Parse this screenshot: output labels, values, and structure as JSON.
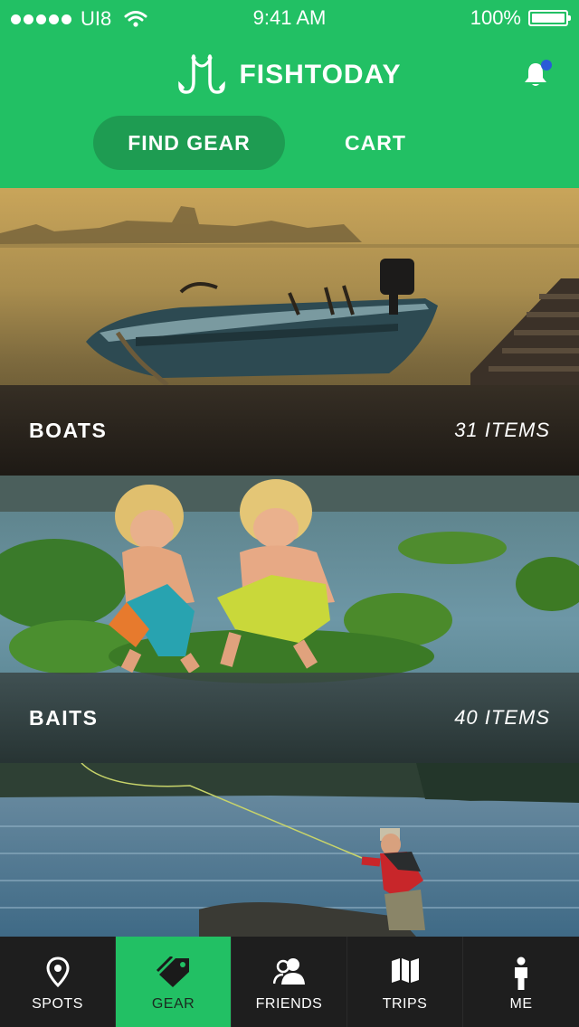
{
  "status_bar": {
    "carrier": "UI8",
    "time": "9:41 AM",
    "battery": "100%",
    "battery_level": 1.0
  },
  "header": {
    "app_name": "FISHTODAY",
    "has_notification": true
  },
  "tabs": [
    {
      "label": "FIND GEAR",
      "active": true
    },
    {
      "label": "CART",
      "active": false
    }
  ],
  "categories": [
    {
      "name": "BOATS",
      "count": "31 ITEMS"
    },
    {
      "name": "BAITS",
      "count": "40 ITEMS"
    }
  ],
  "tabbar": [
    {
      "label": "SPOTS",
      "icon": "map-pin-icon",
      "active": false
    },
    {
      "label": "GEAR",
      "icon": "tag-icon",
      "active": true
    },
    {
      "label": "FRIENDS",
      "icon": "friends-icon",
      "active": false
    },
    {
      "label": "TRIPS",
      "icon": "map-icon",
      "active": false
    },
    {
      "label": "ME",
      "icon": "person-icon",
      "active": false
    }
  ],
  "colors": {
    "brand_green": "#22c064",
    "active_pill": "#1e9c52",
    "tabbar_bg": "#1e1e1e",
    "notification_dot": "#2a5bd7"
  }
}
